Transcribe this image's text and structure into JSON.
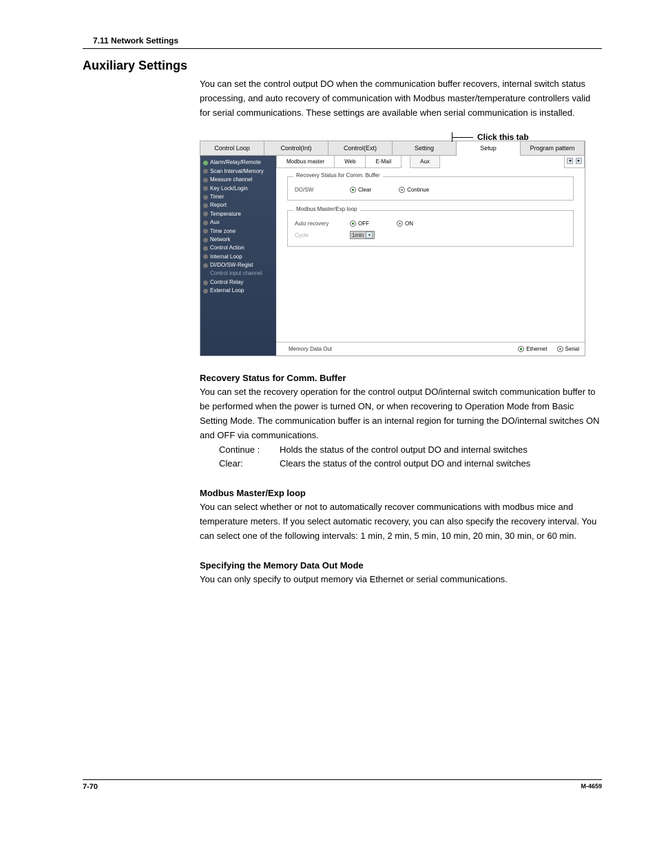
{
  "header": {
    "section": "7.11  Network Settings"
  },
  "title": "Auxiliary Settings",
  "intro": "You can set the control output DO when the communication buffer recovers, internal switch status processing, and auto recovery of communication with Modbus master/temperature controllers valid for serial communications. These settings are available when serial communication is installed.",
  "callout": "Click this tab",
  "app": {
    "topTabs": [
      "Control Loop",
      "Control(Int)",
      "Control(Ext)",
      "Setting",
      "Setup",
      "Program pattern"
    ],
    "activeTopTab": 4,
    "sidebar": [
      "Alarm/Relay/Remote",
      "Scan Interval/Memory",
      "Measure channel",
      "Key Lock/Login",
      "Timer",
      "Report",
      "Temperature",
      "Aux",
      "Time zone",
      "Network",
      "Control Action",
      "Internal Loop",
      "DI/DO/SW-Regist",
      "Control input channel",
      "Control Relay",
      "External Loop"
    ],
    "sidebarSelected": 0,
    "subTabsLeft": [
      "Modbus master",
      "Web",
      "E-Mail"
    ],
    "subTabRight": "Aux",
    "group1": {
      "legend": "Recovery Status for Comm. Buffer",
      "rowLabel": "DO/SW",
      "opt1": "Clear",
      "opt2": "Continue",
      "selected": "Clear"
    },
    "group2": {
      "legend": "Modbus Master/Exp loop",
      "row1Label": "Auto recovery",
      "opt1": "OFF",
      "opt2": "ON",
      "selected": "OFF",
      "row2Label": "Cycle",
      "cycleValue": "1min"
    },
    "footerBar": {
      "label": "Memory Data Out",
      "opt1": "Ethernet",
      "opt2": "Serial",
      "selected": "Ethernet"
    }
  },
  "sections": {
    "s1": {
      "title": "Recovery Status for Comm. Buffer",
      "body": "You can set the recovery operation for the control output DO/internal switch communication buffer to be performed when the power is turned ON, or when recovering to Operation Mode from Basic Setting Mode. The communication buffer is an internal region for turning the DO/internal switches ON and OFF via communications.",
      "defs": [
        {
          "term": "Continue :",
          "desc": "Holds the status of the control output DO and internal switches"
        },
        {
          "term": "Clear:",
          "desc": "Clears the status of the control output DO and internal switches"
        }
      ]
    },
    "s2": {
      "title": "Modbus Master/Exp loop",
      "body": "You can select whether or not to automatically recover communications with modbus mice and temperature meters.  If you select automatic recovery, you can also specify the recovery interval.  You can select one of the following intervals: 1 min, 2 min, 5 min, 10 min, 20 min, 30 min, or 60 min."
    },
    "s3": {
      "title": "Specifying the Memory Data Out Mode",
      "body": "You can only specify to output memory via Ethernet or serial communications."
    }
  },
  "chart_data": {
    "type": "table",
    "title": "Auxiliary Settings configuration values",
    "rows": [
      {
        "group": "Recovery Status for Comm. Buffer",
        "setting": "DO/SW",
        "options": [
          "Clear",
          "Continue"
        ],
        "selected": "Clear"
      },
      {
        "group": "Modbus Master/Exp loop",
        "setting": "Auto recovery",
        "options": [
          "OFF",
          "ON"
        ],
        "selected": "OFF"
      },
      {
        "group": "Modbus Master/Exp loop",
        "setting": "Cycle",
        "options": [
          "1min"
        ],
        "selected": "1min"
      },
      {
        "group": "Memory Data Out",
        "setting": "Mode",
        "options": [
          "Ethernet",
          "Serial"
        ],
        "selected": "Ethernet"
      }
    ]
  },
  "footer": {
    "page": "7-70",
    "doc": "M-4659"
  }
}
